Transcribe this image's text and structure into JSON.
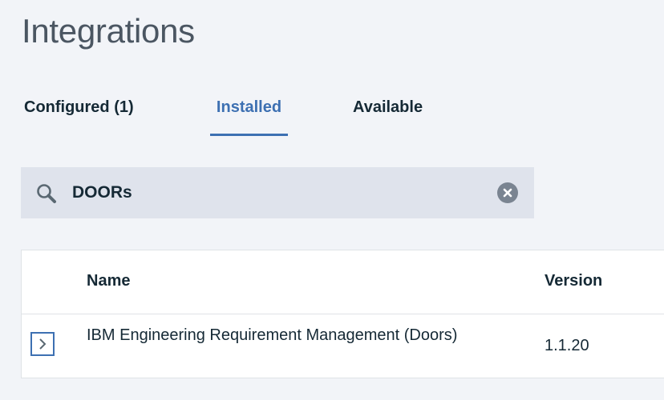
{
  "page": {
    "title": "Integrations"
  },
  "tabs": [
    {
      "label": "Configured (1)",
      "selected": false
    },
    {
      "label": "Installed",
      "selected": true
    },
    {
      "label": "Available",
      "selected": false
    }
  ],
  "search": {
    "value": "DOORs",
    "icon": "search-icon",
    "clear_icon": "close-circle-icon"
  },
  "table": {
    "columns": [
      "Name",
      "Version"
    ],
    "rows": [
      {
        "expand_icon": "chevron-right-icon",
        "name": "IBM Engineering Requirement Management (Doors)",
        "version": "1.1.20"
      }
    ]
  },
  "colors": {
    "accent": "#3d70b2",
    "background": "#f2f4f8",
    "search_background": "#dfe3ec",
    "text": "#152935"
  }
}
